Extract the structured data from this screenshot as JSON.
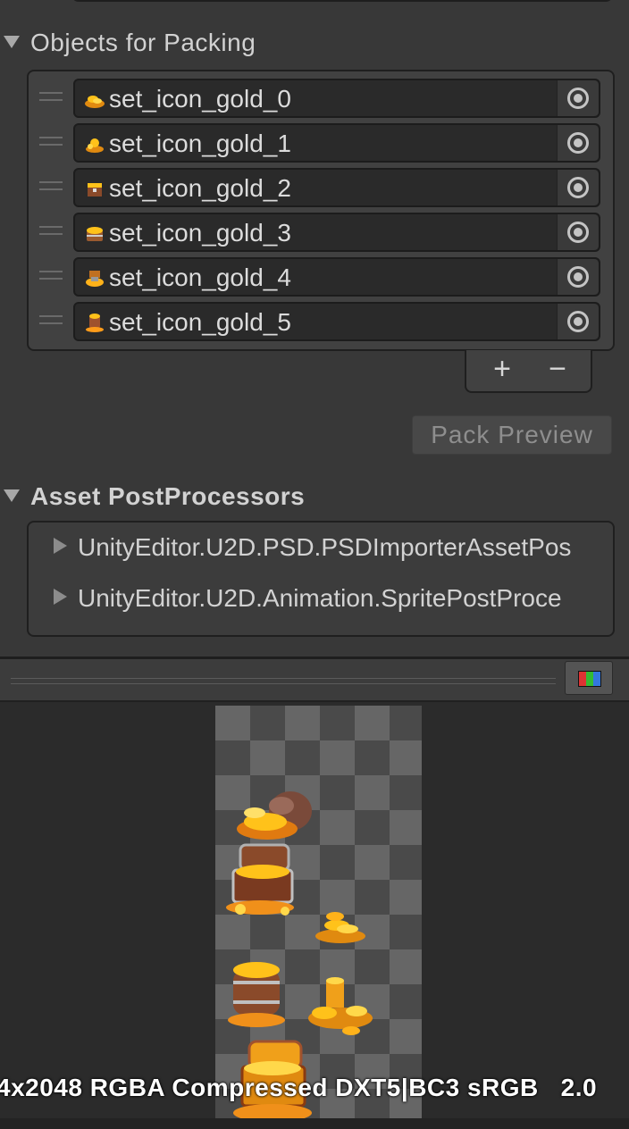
{
  "objects_for_packing": {
    "title": "Objects for Packing",
    "items": [
      {
        "label": "set_icon_gold_0",
        "icon": "gold-pile-icon"
      },
      {
        "label": "set_icon_gold_1",
        "icon": "gold-pile-icon"
      },
      {
        "label": "set_icon_gold_2",
        "icon": "gold-chest-icon"
      },
      {
        "label": "set_icon_gold_3",
        "icon": "gold-chest-icon"
      },
      {
        "label": "set_icon_gold_4",
        "icon": "gold-bag-icon"
      },
      {
        "label": "set_icon_gold_5",
        "icon": "gold-barrel-icon"
      }
    ],
    "add_label": "+",
    "remove_label": "−"
  },
  "pack_preview_label": "Pack Preview",
  "asset_postprocessors": {
    "title": "Asset PostProcessors",
    "items": [
      "UnityEditor.U2D.PSD.PSDImporterAssetPos",
      "UnityEditor.U2D.Animation.SpritePostProce"
    ]
  },
  "preview": {
    "info_text": "4x2048 RGBA Compressed DXT5|BC3 sRGB   2.0",
    "channel_button_icon": "rgb-channels-icon"
  }
}
